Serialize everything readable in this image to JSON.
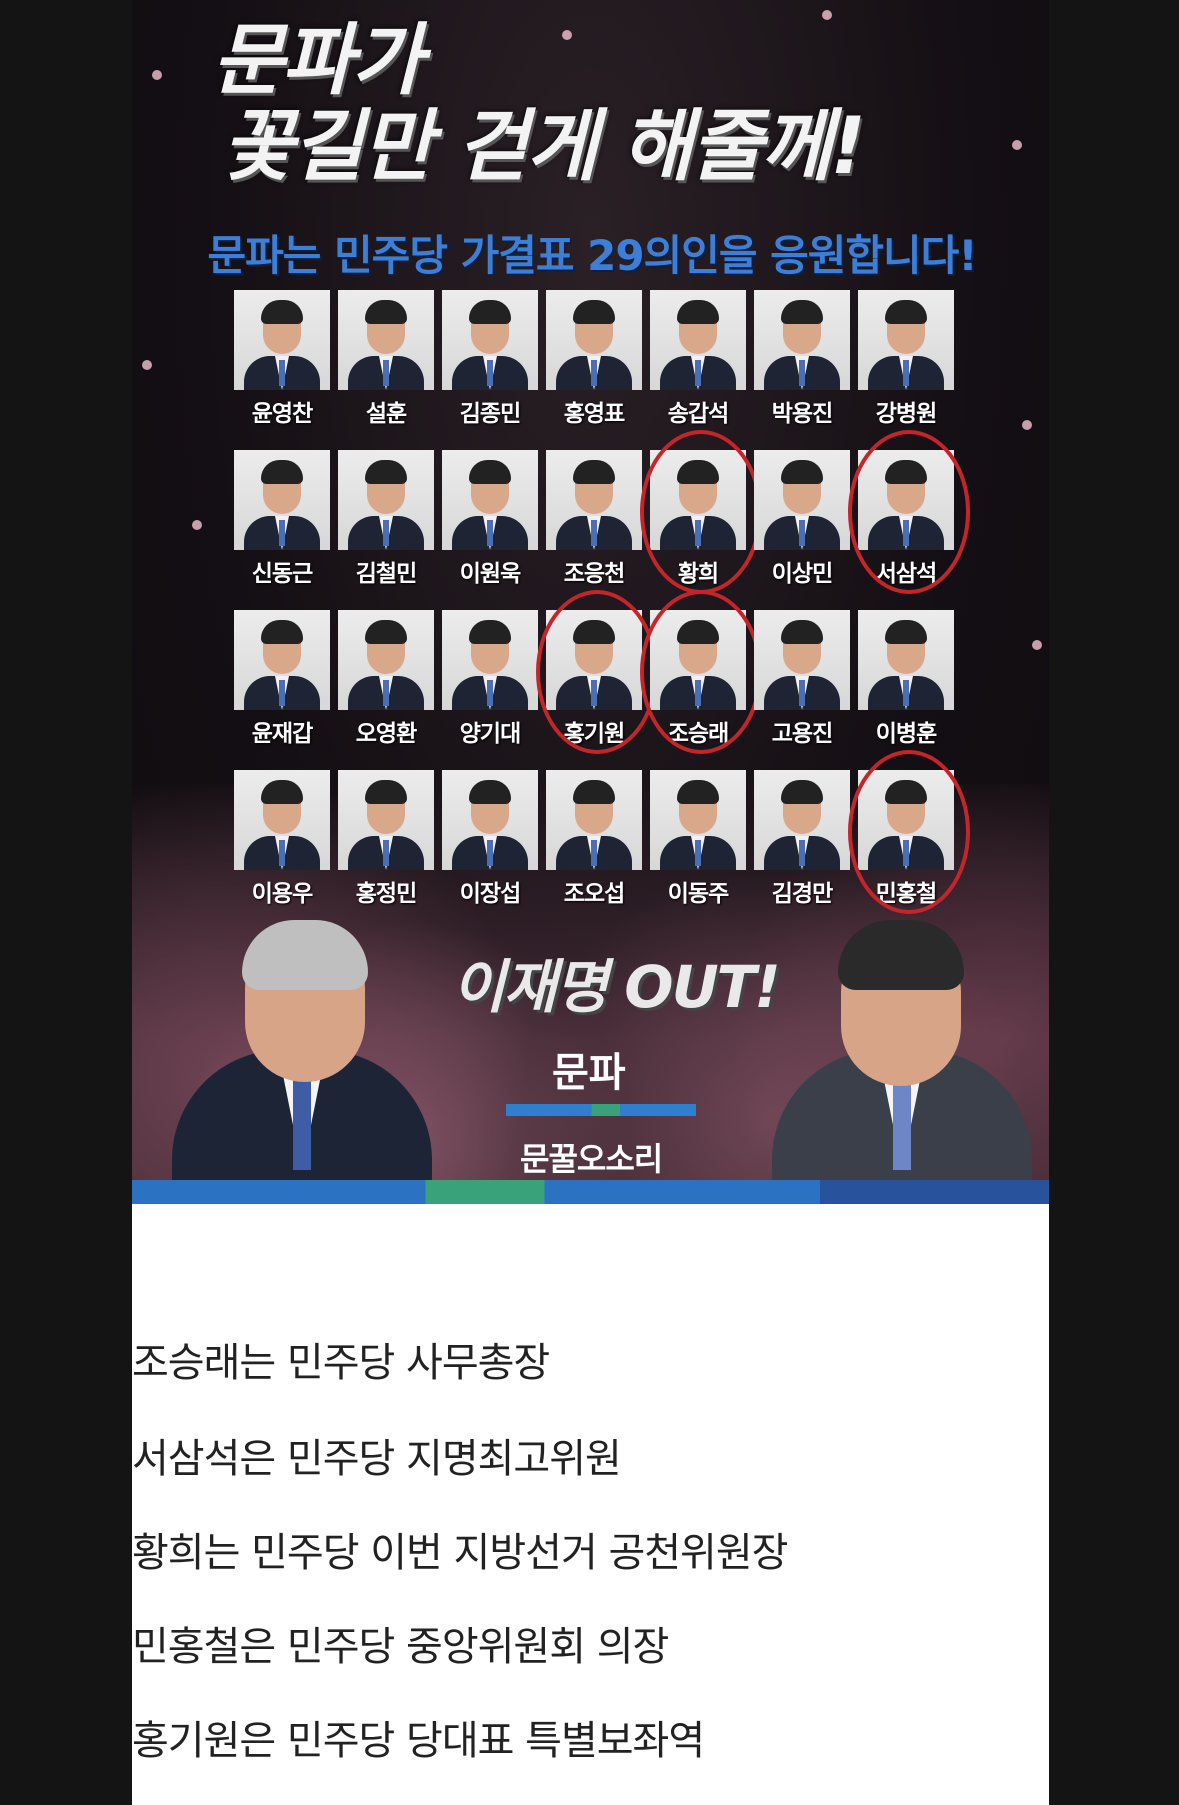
{
  "poster": {
    "title_line1": "문파가",
    "title_line2": "꽃길만 걷게 해줄께!",
    "subtitle": "문파는 민주당 가결표 29의인을 응원합니다!",
    "members": [
      {
        "name": "윤영찬",
        "circled": false
      },
      {
        "name": "설훈",
        "circled": false
      },
      {
        "name": "김종민",
        "circled": false
      },
      {
        "name": "홍영표",
        "circled": false
      },
      {
        "name": "송갑석",
        "circled": false
      },
      {
        "name": "박용진",
        "circled": false
      },
      {
        "name": "강병원",
        "circled": false
      },
      {
        "name": "신동근",
        "circled": false
      },
      {
        "name": "김철민",
        "circled": false
      },
      {
        "name": "이원욱",
        "circled": false
      },
      {
        "name": "조응천",
        "circled": false
      },
      {
        "name": "황희",
        "circled": true
      },
      {
        "name": "이상민",
        "circled": false
      },
      {
        "name": "서삼석",
        "circled": true
      },
      {
        "name": "윤재갑",
        "circled": false
      },
      {
        "name": "오영환",
        "circled": false
      },
      {
        "name": "양기대",
        "circled": false
      },
      {
        "name": "홍기원",
        "circled": true
      },
      {
        "name": "조승래",
        "circled": true
      },
      {
        "name": "고용진",
        "circled": false
      },
      {
        "name": "이병훈",
        "circled": false
      },
      {
        "name": "이용우",
        "circled": false
      },
      {
        "name": "홍정민",
        "circled": false
      },
      {
        "name": "이장섭",
        "circled": false
      },
      {
        "name": "조오섭",
        "circled": false
      },
      {
        "name": "이동주",
        "circled": false
      },
      {
        "name": "김경만",
        "circled": false
      },
      {
        "name": "민홍철",
        "circled": true
      }
    ],
    "out_text": "이재명 OUT!",
    "signature": "문파",
    "footer_brand": "문꿀오소리"
  },
  "caption": {
    "lines": [
      "조승래는 민주당 사무총장",
      "서삼석은 민주당 지명최고위원",
      "황희는 민주당 이번 지방선거 공천위원장",
      "민홍철은 민주당 중앙위원회 의장",
      "홍기원은 민주당 당대표 특별보좌역"
    ]
  },
  "colors": {
    "background": "#141414",
    "subtitle_blue": "#3d7fd6",
    "circle_red": "#c2262b",
    "caption_background": "#ffffff"
  }
}
